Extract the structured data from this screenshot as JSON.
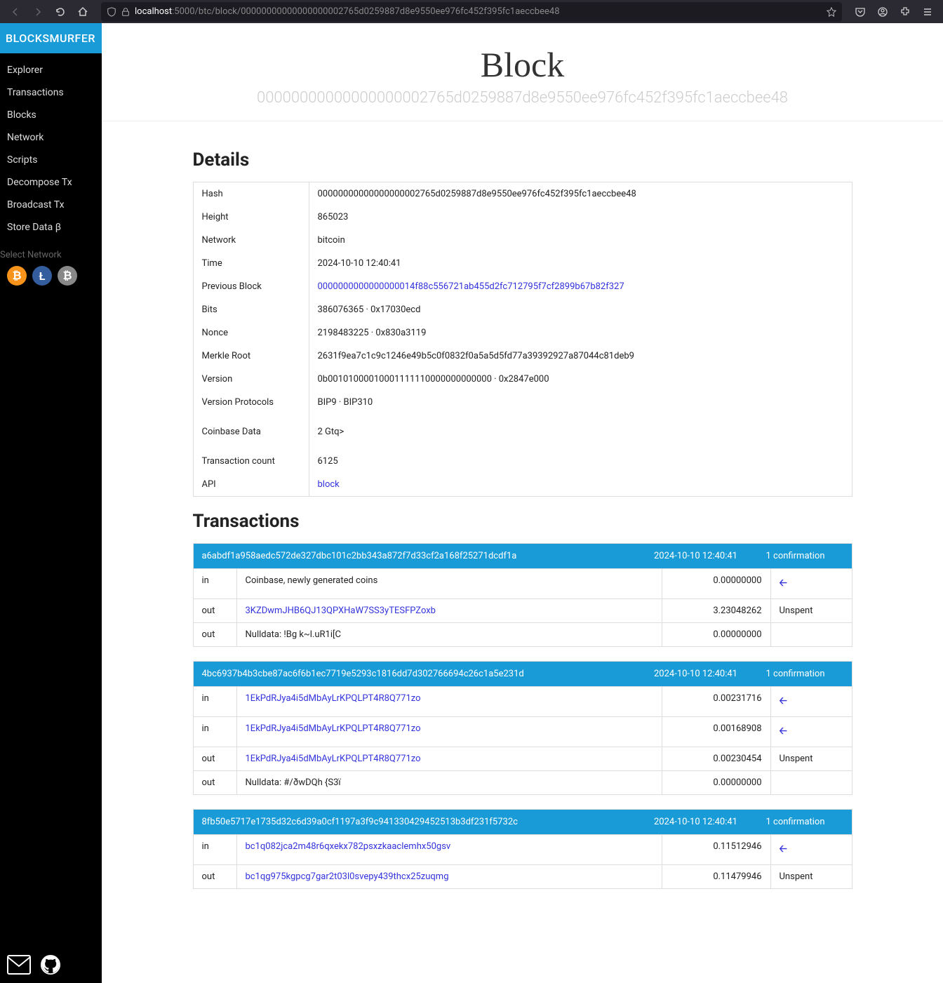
{
  "browser": {
    "url_host": "localhost",
    "url_path": ":5000/btc/block/00000000000000000002765d0259887d8e9550ee976fc452f395fc1aeccbee48"
  },
  "brand": "BLOCKSMURFER",
  "nav": [
    "Explorer",
    "Transactions",
    "Blocks",
    "Network",
    "Scripts",
    "Decompose Tx",
    "Broadcast Tx",
    "Store Data β"
  ],
  "select_network_label": "Select Network",
  "coins": {
    "btc": "₿",
    "ltc": "Ł",
    "bch": "₿"
  },
  "hero": {
    "title": "Block",
    "hash": "00000000000000000002765d0259887d8e9550ee976fc452f395fc1aeccbee48"
  },
  "details_heading": "Details",
  "details": {
    "Hash": "00000000000000000002765d0259887d8e9550ee976fc452f395fc1aeccbee48",
    "Height": "865023",
    "Network": "bitcoin",
    "Time": "2024-10-10 12:40:41",
    "PreviousBlock_label": "Previous Block",
    "PreviousBlock": "0000000000000000014f88c556721ab455d2fc712795f7cf2899b67b82f327",
    "Bits": "386076365 · 0x17030ecd",
    "Nonce": "2198483225 · 0x830a3119",
    "MerkleRoot_label": "Merkle Root",
    "MerkleRoot": "2631f9ea7c1c9c1246e49b5c0f0832f0a5a5d5fd77a39392927a87044c81deb9",
    "Version": "0b00101000010001111110000000000000 · 0x2847e000",
    "VersionProtocols_label": "Version Protocols",
    "VersionProtocols": "BIP9 · BIP310",
    "CoinbaseData_label": "Coinbase Data",
    "CoinbaseData": "2    Gtq>",
    "TransactionCount_label": "Transaction count",
    "TransactionCount": "6125",
    "API_label": "API",
    "API": "block"
  },
  "tx_heading": "Transactions",
  "txs": [
    {
      "hash": "a6abdf1a958aedc572de327dbc101c2bb343a872f7d33cf2a168f25271dcdf1a",
      "date": "2024-10-10 12:40:41",
      "conf": "1 confirmation",
      "rows": [
        {
          "dir": "in",
          "addr": "Coinbase, newly generated coins",
          "link": false,
          "amt": "0.00000000",
          "status": "arrow"
        },
        {
          "dir": "out",
          "addr": "3KZDwmJHB6QJ13QPXHaW7SS3yTESFPZoxb",
          "link": true,
          "amt": "3.23048262",
          "status": "Unspent"
        },
        {
          "dir": "out",
          "addr": "Nulldata: !Bg k~l.uR1i[C",
          "link": false,
          "amt": "0.00000000",
          "status": ""
        }
      ]
    },
    {
      "hash": "4bc6937b4b3cbe87ac6f6b1ec7719e5293c1816dd7d302766694c26c1a5e231d",
      "date": "2024-10-10 12:40:41",
      "conf": "1 confirmation",
      "rows": [
        {
          "dir": "in",
          "addr": "1EkPdRJya4i5dMbAyLrKPQLPT4R8Q771zo",
          "link": true,
          "amt": "0.00231716",
          "status": "arrow"
        },
        {
          "dir": "in",
          "addr": "1EkPdRJya4i5dMbAyLrKPQLPT4R8Q771zo",
          "link": true,
          "amt": "0.00168908",
          "status": "arrow"
        },
        {
          "dir": "out",
          "addr": "1EkPdRJya4i5dMbAyLrKPQLPT4R8Q771zo",
          "link": true,
          "amt": "0.00230454",
          "status": "Unspent"
        },
        {
          "dir": "out",
          "addr": "Nulldata: #/ðwDQh {S3ï",
          "link": false,
          "amt": "0.00000000",
          "status": ""
        }
      ]
    },
    {
      "hash": "8fb50e5717e1735d32c6d39a0cf1197a3f9c941330429452513b3df231f5732c",
      "date": "2024-10-10 12:40:41",
      "conf": "1 confirmation",
      "rows": [
        {
          "dir": "in",
          "addr": "bc1q082jca2m48r6qxekx782psxzkaaclemhx50gsv",
          "link": true,
          "amt": "0.11512946",
          "status": "arrow"
        },
        {
          "dir": "out",
          "addr": "bc1qg975kgpcg7gar2t03l0svepy439thcx25zuqmg",
          "link": true,
          "amt": "0.11479946",
          "status": "Unspent"
        }
      ]
    }
  ]
}
